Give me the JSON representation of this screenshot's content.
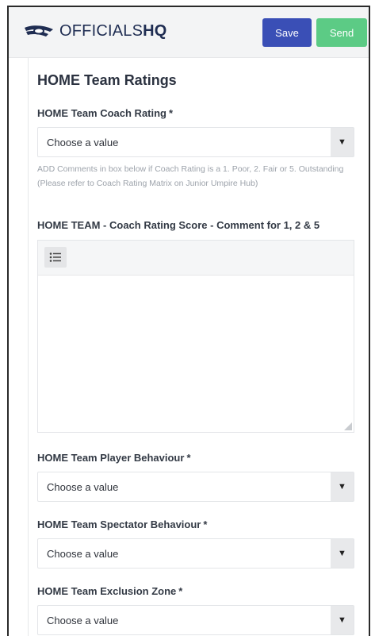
{
  "header": {
    "logo_text_light": "OFFICIALS",
    "logo_text_bold": "HQ",
    "save_label": "Save",
    "send_label": "Send",
    "colors": {
      "save": "#3a4fb6",
      "send": "#5ccb85",
      "brand": "#1f2d52"
    }
  },
  "form": {
    "section_title": "HOME Team Ratings",
    "coach_rating": {
      "label": "HOME Team Coach Rating",
      "required_mark": "*",
      "value": "Choose a value",
      "help": "ADD Comments in box below if Coach Rating is a 1. Poor, 2. Fair or 5. Outstanding (Please refer to Coach Rating Matrix on Junior Umpire Hub)"
    },
    "coach_comment": {
      "label": "HOME TEAM - Coach Rating Score - Comment for 1, 2 & 5",
      "toolbar_icon": "bulleted-list-icon",
      "value": ""
    },
    "player_behaviour": {
      "label": "HOME Team Player Behaviour",
      "required_mark": "*",
      "value": "Choose a value"
    },
    "spectator_behaviour": {
      "label": "HOME Team Spectator Behaviour",
      "required_mark": "*",
      "value": "Choose a value"
    },
    "exclusion_zone": {
      "label": "HOME Team Exclusion Zone",
      "required_mark": "*",
      "value": "Choose a value"
    },
    "caret_glyph": "▼"
  }
}
